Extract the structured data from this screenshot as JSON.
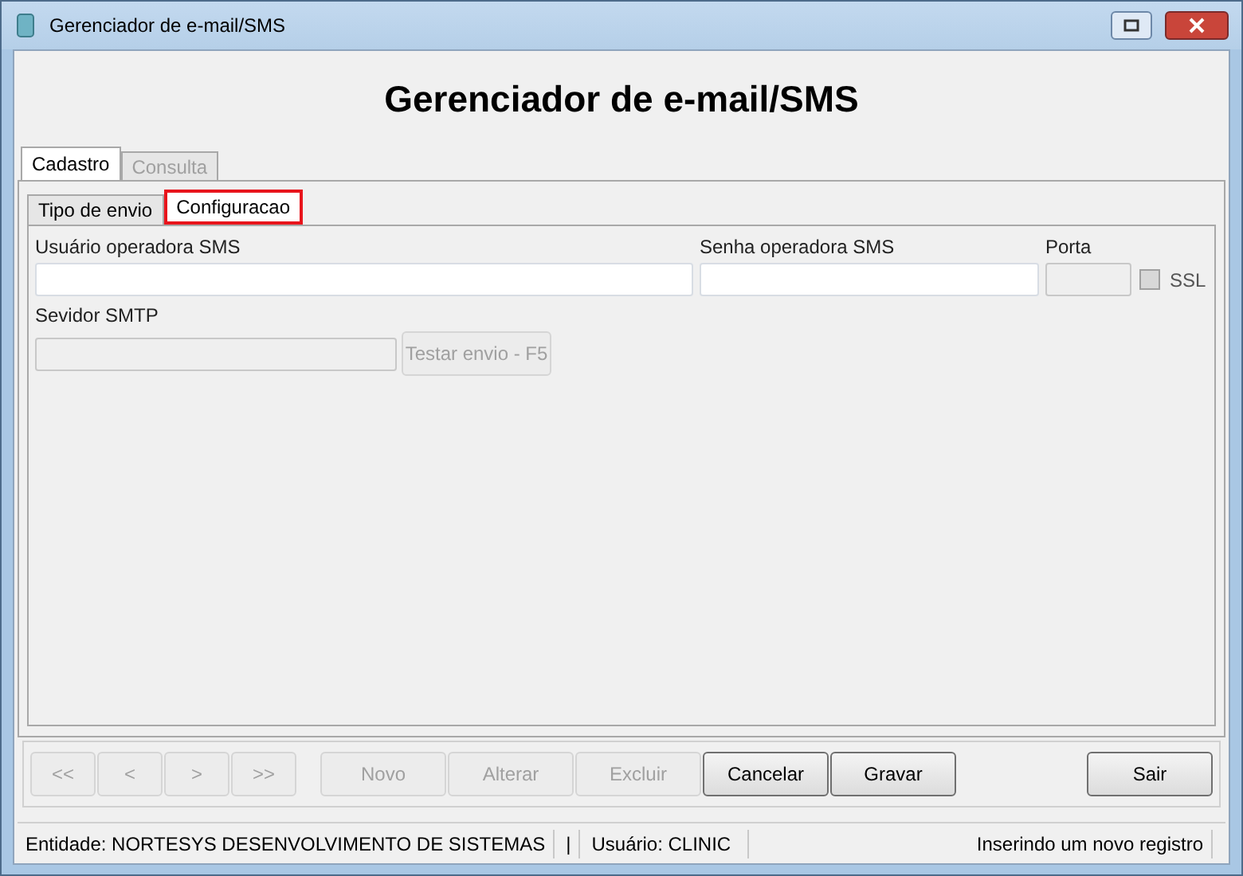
{
  "window": {
    "title": "Gerenciador de e-mail/SMS"
  },
  "header": "Gerenciador de e-mail/SMS",
  "tabs": [
    {
      "label": "Cadastro",
      "selected": true,
      "disabled": false
    },
    {
      "label": "Consulta",
      "selected": false,
      "disabled": true
    }
  ],
  "subtabs": [
    {
      "label": "Tipo de envio",
      "selected": false,
      "highlighted": false
    },
    {
      "label": "Configuracao",
      "selected": true,
      "highlighted": true
    }
  ],
  "fields": [
    {
      "label": "Usuário operadora SMS",
      "disabled": false
    },
    {
      "label": "Senha operadora SMS",
      "disabled": false
    },
    {
      "label": "Porta",
      "disabled": true
    }
  ],
  "ssl": {
    "label": "SSL",
    "checked": false,
    "disabled": true
  },
  "smtp": {
    "label": "Sevidor SMTP",
    "disabled": true
  },
  "test_button": {
    "label": "Testar envio - F5",
    "disabled": true
  },
  "nav_buttons": [
    {
      "label": "<<",
      "disabled": true
    },
    {
      "label": "<",
      "disabled": true
    },
    {
      "label": ">",
      "disabled": true
    },
    {
      "label": ">>",
      "disabled": true
    }
  ],
  "action_buttons": [
    {
      "label": "Novo",
      "disabled": true
    },
    {
      "label": "Alterar",
      "disabled": true
    },
    {
      "label": "Excluir",
      "disabled": true
    },
    {
      "label": "Cancelar",
      "disabled": false
    },
    {
      "label": "Gravar",
      "disabled": false
    }
  ],
  "exit_button": {
    "label": "Sair",
    "disabled": false
  },
  "status_bar": [
    "Entidade: NORTESYS DESENVOLVIMENTO DE SISTEMAS",
    "|",
    "Usuário: CLINIC",
    "Inserindo um novo registro"
  ]
}
